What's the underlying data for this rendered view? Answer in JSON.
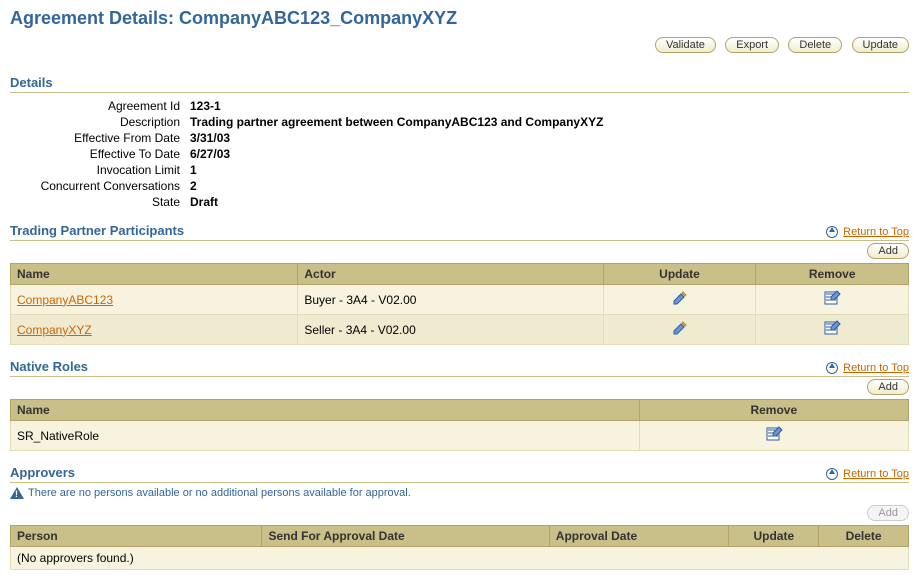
{
  "page_title": "Agreement Details: CompanyABC123_CompanyXYZ",
  "toolbar": {
    "validate": "Validate",
    "export": "Export",
    "delete": "Delete",
    "update": "Update"
  },
  "return_link": "Return to Top",
  "add_label": "Add",
  "details": {
    "heading": "Details",
    "rows": [
      {
        "label": "Agreement Id",
        "value": "123-1"
      },
      {
        "label": "Description",
        "value": "Trading partner agreement between CompanyABC123 and CompanyXYZ"
      },
      {
        "label": "Effective From Date",
        "value": "3/31/03"
      },
      {
        "label": "Effective To Date",
        "value": "6/27/03"
      },
      {
        "label": "Invocation Limit",
        "value": "1"
      },
      {
        "label": "Concurrent Conversations",
        "value": "2"
      },
      {
        "label": "State",
        "value": "Draft"
      }
    ]
  },
  "participants": {
    "heading": "Trading Partner Participants",
    "columns": {
      "name": "Name",
      "actor": "Actor",
      "update": "Update",
      "remove": "Remove"
    },
    "rows": [
      {
        "name": "CompanyABC123",
        "actor": "Buyer - 3A4 - V02.00"
      },
      {
        "name": "CompanyXYZ",
        "actor": "Seller - 3A4 - V02.00"
      }
    ]
  },
  "native_roles": {
    "heading": "Native Roles",
    "columns": {
      "name": "Name",
      "remove": "Remove"
    },
    "rows": [
      {
        "name": "SR_NativeRole"
      }
    ]
  },
  "approvers": {
    "heading": "Approvers",
    "info": "There are no persons available or no additional persons available for approval.",
    "columns": {
      "person": "Person",
      "send": "Send For Approval Date",
      "approval": "Approval Date",
      "update": "Update",
      "delete": "Delete"
    },
    "empty_text": "(No approvers found.)"
  }
}
